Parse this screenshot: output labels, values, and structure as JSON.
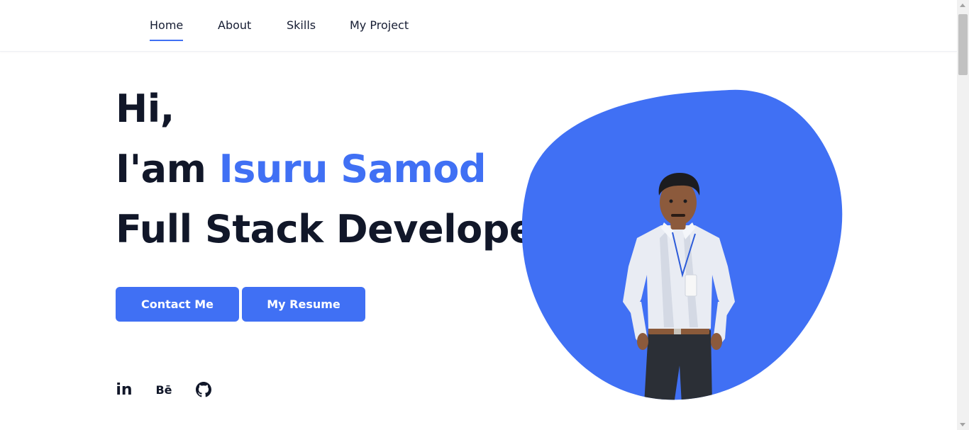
{
  "nav": {
    "items": [
      {
        "label": "Home",
        "active": true
      },
      {
        "label": "About",
        "active": false
      },
      {
        "label": "Skills",
        "active": false
      },
      {
        "label": "My Project",
        "active": false
      }
    ]
  },
  "hero": {
    "greeting": "Hi,",
    "intro_prefix": "I'am",
    "name": "Isuru Samod",
    "role": "Full Stack Developer"
  },
  "buttons": {
    "contact": "Contact Me",
    "resume": "My Resume"
  },
  "social": {
    "linkedin_label": "in",
    "behance_label": "Bē",
    "github_icon": "github-icon"
  },
  "colors": {
    "accent": "#4070f4",
    "text_dark": "#111729"
  }
}
